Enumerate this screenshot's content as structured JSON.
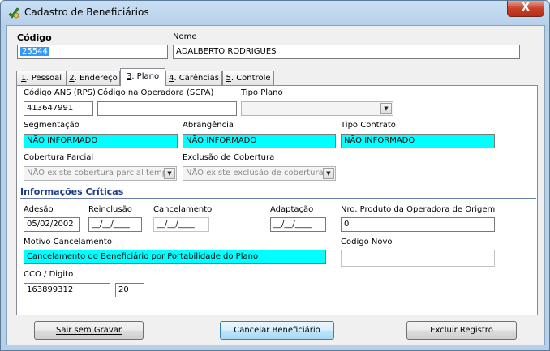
{
  "window": {
    "title": "Cadastro de Beneficiários",
    "close_label": "X"
  },
  "header": {
    "codigo_label": "Código",
    "codigo_value": "25544",
    "nome_label": "Nome",
    "nome_value": "ADALBERTO RODRIGUES"
  },
  "tabs": [
    {
      "num": "1",
      "label": ". Pessoal"
    },
    {
      "num": "2",
      "label": ". Endereço"
    },
    {
      "num": "3",
      "label": ". Plano"
    },
    {
      "num": "4",
      "label": ". Carências"
    },
    {
      "num": "5",
      "label": ". Controle"
    }
  ],
  "plano": {
    "codigo_ans_label": "Código ANS (RPS)",
    "codigo_ans_value": "413647991",
    "codigo_operadora_label": "Código na Operadora (SCPA)",
    "codigo_operadora_value": "",
    "tipo_plano_label": "Tipo Plano",
    "tipo_plano_value": "",
    "segmentacao_label": "Segmentação",
    "segmentacao_value": "NÃO INFORMADO",
    "abrangencia_label": "Abrangência",
    "abrangencia_value": "NÃO INFORMADO",
    "tipo_contrato_label": "Tipo Contrato",
    "tipo_contrato_value": "NÃO INFORMADO",
    "cobertura_parcial_label": "Cobertura Parcial",
    "cobertura_parcial_value": "NÃO existe cobertura parcial temp",
    "exclusao_cobertura_label": "Exclusão de Cobertura",
    "exclusao_cobertura_value": "NÃO existe exclusão de cobertura"
  },
  "criticas": {
    "section_title": "Informações Críticas",
    "adesao_label": "Adesão",
    "adesao_value": "05/02/2002",
    "reinclusao_label": "Reinclusão",
    "reinclusao_value": "__/__/____",
    "cancelamento_label": "Cancelamento",
    "cancelamento_value": "__/__/____",
    "adaptacao_label": "Adaptação",
    "adaptacao_value": "__/__/____",
    "nro_produto_label": "Nro. Produto da Operadora de Origem",
    "nro_produto_value": "0",
    "motivo_label": "Motivo Cancelamento",
    "motivo_value": "Cancelamento do Beneficiário por Portabilidade do Plano",
    "codigo_novo_label": "Codigo Novo",
    "codigo_novo_value": "",
    "cco_label": "CCO / Digito",
    "cco_value": "163899312",
    "digito_value": "20"
  },
  "buttons": {
    "sair": "Sair sem Gravar",
    "cancelar": "Cancelar Beneficiário",
    "excluir": "Excluir Registro"
  },
  "colors": {
    "highlight_field": "#00ffff",
    "section_title": "#1b3a8a",
    "close_button": "#c8402a"
  }
}
